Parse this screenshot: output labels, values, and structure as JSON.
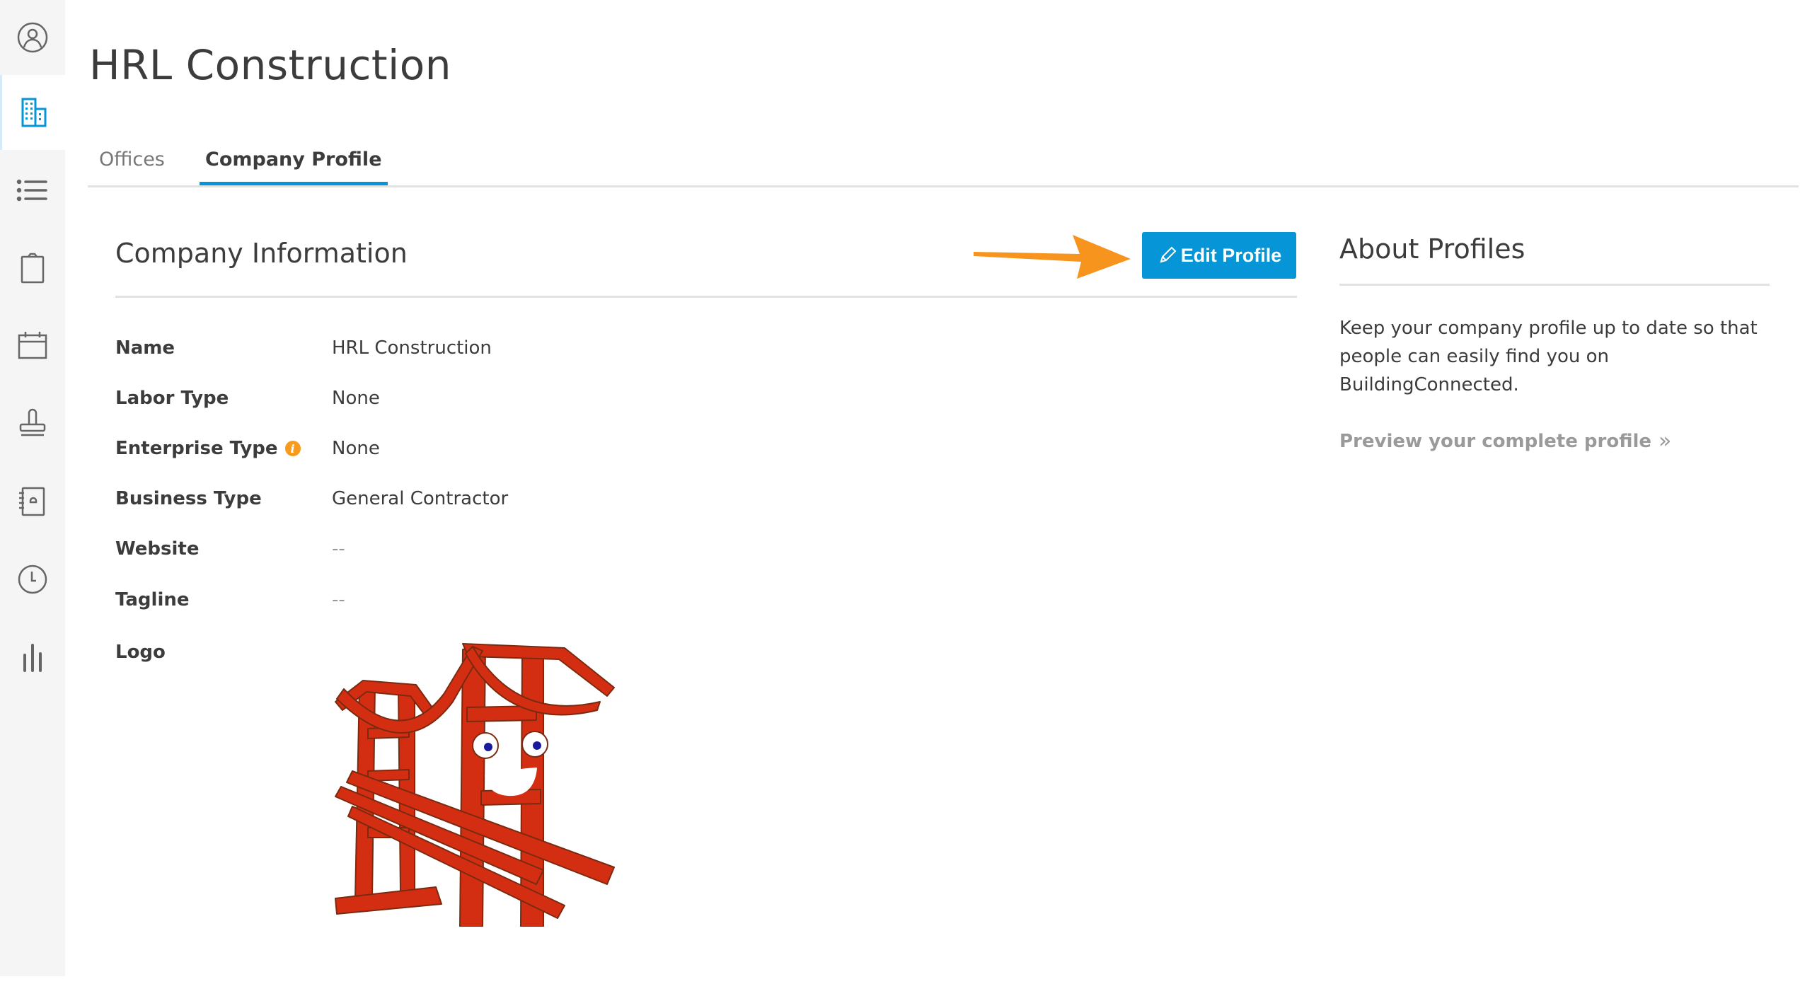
{
  "sidebar": {
    "items": [
      {
        "icon": "user-circle-icon",
        "active": false
      },
      {
        "icon": "buildings-icon",
        "active": true
      },
      {
        "icon": "list-icon",
        "active": false
      },
      {
        "icon": "clipboard-icon",
        "active": false
      },
      {
        "icon": "calendar-icon",
        "active": false
      },
      {
        "icon": "stamp-icon",
        "active": false
      },
      {
        "icon": "address-book-icon",
        "active": false
      },
      {
        "icon": "clock-icon",
        "active": false
      },
      {
        "icon": "bar-chart-icon",
        "active": false
      }
    ]
  },
  "page": {
    "title": "HRL Construction"
  },
  "tabs": [
    {
      "label": "Offices",
      "active": false
    },
    {
      "label": "Company Profile",
      "active": true
    }
  ],
  "company_info": {
    "title": "Company Information",
    "edit_button": "Edit Profile",
    "fields": [
      {
        "label": "Name",
        "value": "HRL Construction"
      },
      {
        "label": "Labor Type",
        "value": "None"
      },
      {
        "label": "Enterprise Type",
        "value": "None",
        "info_icon": "i"
      },
      {
        "label": "Business Type",
        "value": "General Contractor"
      },
      {
        "label": "Website",
        "value": "--"
      },
      {
        "label": "Tagline",
        "value": "--"
      },
      {
        "label": "Logo",
        "value": ""
      }
    ]
  },
  "about": {
    "title": "About Profiles",
    "body": "Keep your company profile up to date so that people can easily find you on BuildingConnected.",
    "link": "Preview your complete profile",
    "link_icon": "»"
  },
  "colors": {
    "accent": "#0696d7",
    "annotation_arrow": "#f7941d",
    "info_badge": "#f89a1c",
    "logo_red": "#d42e12"
  }
}
